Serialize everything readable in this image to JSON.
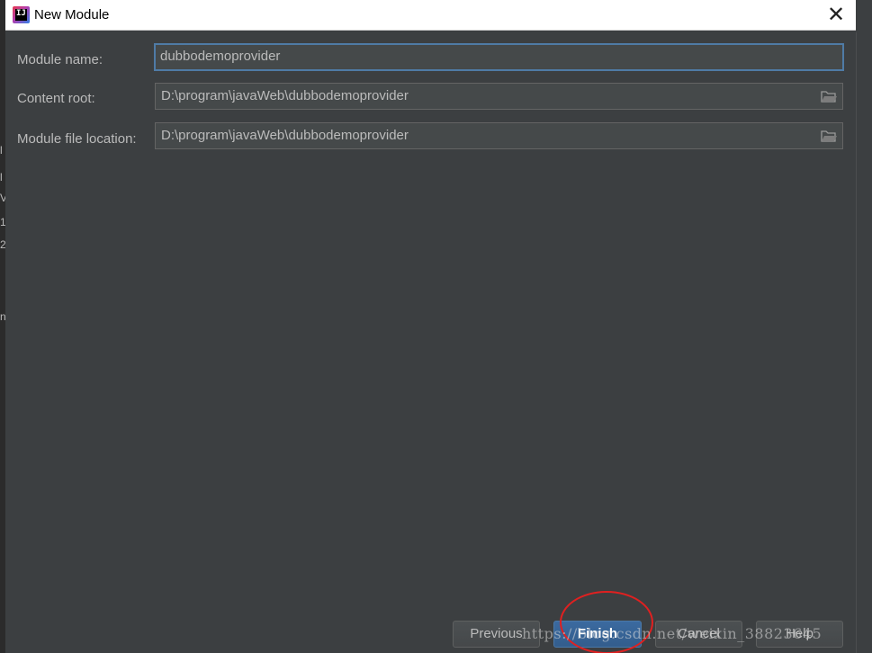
{
  "window": {
    "title": "New Module",
    "close_glyph": "✕"
  },
  "form": {
    "module_name": {
      "label": "Module name:",
      "value": "dubbodemoprovider"
    },
    "content_root": {
      "label": "Content root:",
      "value": "D:\\program\\javaWeb\\dubbodemoprovider"
    },
    "module_file_location": {
      "label": "Module file location:",
      "value": "D:\\program\\javaWeb\\dubbodemoprovider"
    }
  },
  "footer": {
    "previous_label": "Previous",
    "finish_label": "Finish",
    "cancel_label": "Cancel",
    "help_label": "Help"
  },
  "watermark": "https://blog.csdn.net/weixin_38823645",
  "colors": {
    "dialog_bg": "#3c3f41",
    "field_bg": "#45494a",
    "focus_border": "#4f7ba6",
    "default_button": "#365880",
    "annotation_red": "#e02020"
  },
  "icons": {
    "app": "intellij-idea-icon",
    "browse": "folder-icon",
    "close": "close-icon"
  }
}
